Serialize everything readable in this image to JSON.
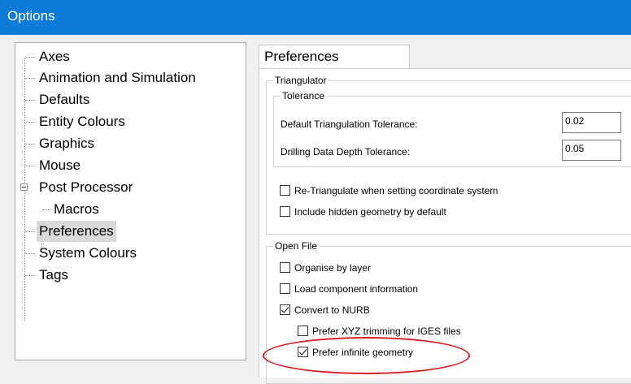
{
  "window": {
    "title": "Options"
  },
  "tree": {
    "items": [
      {
        "label": "Axes"
      },
      {
        "label": "Animation and Simulation"
      },
      {
        "label": "Defaults"
      },
      {
        "label": "Entity Colours"
      },
      {
        "label": "Graphics"
      },
      {
        "label": "Mouse"
      },
      {
        "label": "Post Processor",
        "expanded": true
      },
      {
        "label": "Macros",
        "child": true
      },
      {
        "label": "Preferences",
        "selected": true
      },
      {
        "label": "System Colours"
      },
      {
        "label": "Tags"
      }
    ]
  },
  "tab": {
    "label": "Preferences"
  },
  "triangulator": {
    "title": "Triangulator",
    "tolerance": {
      "title": "Tolerance",
      "default_label": "Default Triangulation Tolerance:",
      "default_value": "0.02",
      "drilling_label": "Drilling Data Depth Tolerance:",
      "drilling_value": "0.05"
    },
    "retriangulate": {
      "label": "Re-Triangulate when setting coordinate system",
      "checked": false
    },
    "include_hidden": {
      "label": "Include hidden geometry by default",
      "checked": false
    }
  },
  "open_file": {
    "title": "Open File",
    "organise_by_layer": {
      "label": "Organise by layer",
      "checked": false
    },
    "load_component_info": {
      "label": "Load component information",
      "checked": false
    },
    "convert_to_nurb": {
      "label": "Convert to NURB",
      "checked": true
    },
    "prefer_xyz_trimming": {
      "label": "Prefer XYZ trimming for IGES files",
      "checked": false
    },
    "prefer_infinite_geometry": {
      "label": "Prefer infinite geometry",
      "checked": true
    }
  },
  "colors": {
    "titlebar": "#0f7bd8",
    "highlight": "#d62020",
    "selection": "#d9d9d9"
  }
}
